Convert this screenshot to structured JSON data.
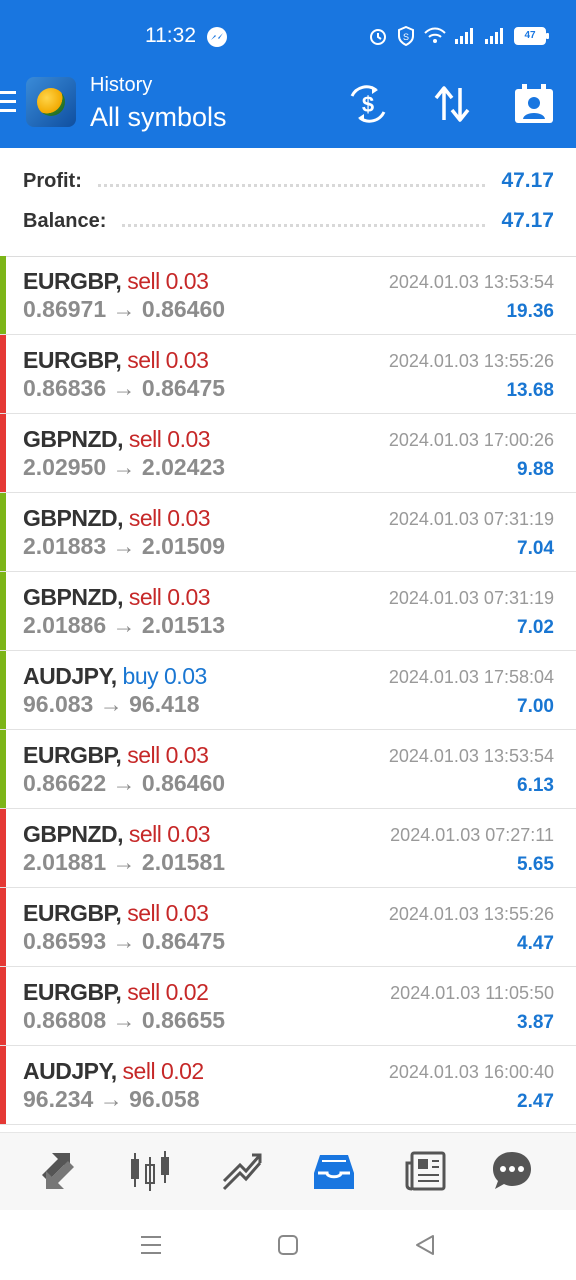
{
  "status_bar": {
    "time": "11:32",
    "battery": "47"
  },
  "header": {
    "subtitle": "History",
    "title": "All symbols"
  },
  "summary": {
    "profit_label": "Profit:",
    "profit_value": "47.17",
    "balance_label": "Balance:",
    "balance_value": "47.17"
  },
  "deals": [
    {
      "symbol": "EURGBP,",
      "side": "sell 0.03",
      "open": "0.86971",
      "close": "0.86460",
      "time": "2024.01.03 13:53:54",
      "profit": "19.36",
      "bar": "green"
    },
    {
      "symbol": "EURGBP,",
      "side": "sell 0.03",
      "open": "0.86836",
      "close": "0.86475",
      "time": "2024.01.03 13:55:26",
      "profit": "13.68",
      "bar": "red"
    },
    {
      "symbol": "GBPNZD,",
      "side": "sell 0.03",
      "open": "2.02950",
      "close": "2.02423",
      "time": "2024.01.03 17:00:26",
      "profit": "9.88",
      "bar": "red"
    },
    {
      "symbol": "GBPNZD,",
      "side": "sell 0.03",
      "open": "2.01883",
      "close": "2.01509",
      "time": "2024.01.03 07:31:19",
      "profit": "7.04",
      "bar": "green"
    },
    {
      "symbol": "GBPNZD,",
      "side": "sell 0.03",
      "open": "2.01886",
      "close": "2.01513",
      "time": "2024.01.03 07:31:19",
      "profit": "7.02",
      "bar": "green"
    },
    {
      "symbol": "AUDJPY,",
      "side": "buy 0.03",
      "open": "96.083",
      "close": "96.418",
      "time": "2024.01.03 17:58:04",
      "profit": "7.00",
      "bar": "green"
    },
    {
      "symbol": "EURGBP,",
      "side": "sell 0.03",
      "open": "0.86622",
      "close": "0.86460",
      "time": "2024.01.03 13:53:54",
      "profit": "6.13",
      "bar": "green"
    },
    {
      "symbol": "GBPNZD,",
      "side": "sell 0.03",
      "open": "2.01881",
      "close": "2.01581",
      "time": "2024.01.03 07:27:11",
      "profit": "5.65",
      "bar": "red"
    },
    {
      "symbol": "EURGBP,",
      "side": "sell 0.03",
      "open": "0.86593",
      "close": "0.86475",
      "time": "2024.01.03 13:55:26",
      "profit": "4.47",
      "bar": "red"
    },
    {
      "symbol": "EURGBP,",
      "side": "sell 0.02",
      "open": "0.86808",
      "close": "0.86655",
      "time": "2024.01.03 11:05:50",
      "profit": "3.87",
      "bar": "red"
    },
    {
      "symbol": "AUDJPY,",
      "side": "sell 0.02",
      "open": "96.234",
      "close": "96.058",
      "time": "2024.01.03 16:00:40",
      "profit": "2.47",
      "bar": "red"
    }
  ],
  "arrow": "→",
  "colors": {
    "accent": "#1976e0",
    "bar_green": "#7cb518",
    "bar_red": "#e53935",
    "sell": "#c62828",
    "buy": "#1976d2"
  },
  "bottom_nav": [
    {
      "icon": "quotes-icon"
    },
    {
      "icon": "chart-icon"
    },
    {
      "icon": "trade-icon"
    },
    {
      "icon": "history-icon",
      "active": true
    },
    {
      "icon": "news-icon"
    },
    {
      "icon": "chat-icon"
    }
  ]
}
